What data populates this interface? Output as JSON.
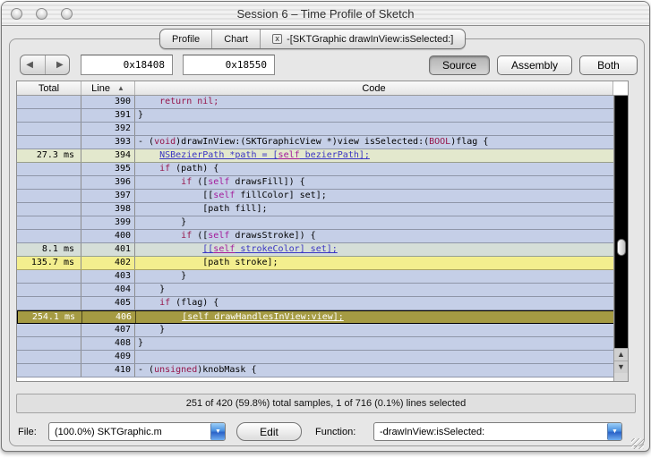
{
  "window": {
    "title": "Session 6 – Time Profile of Sketch"
  },
  "tabs": {
    "items": [
      {
        "label": "Profile"
      },
      {
        "label": "Chart"
      },
      {
        "label": "-[SKTGraphic drawInView:isSelected:]",
        "close_glyph": "x"
      }
    ]
  },
  "toolbar": {
    "back_glyph": "◀",
    "forward_glyph": "▶",
    "address_start": "0x18408",
    "address_end": "0x18550",
    "view_modes": {
      "source": "Source",
      "assembly": "Assembly",
      "both": "Both"
    }
  },
  "table": {
    "columns": {
      "total": "Total",
      "line": "Line",
      "code": "Code"
    },
    "sort_glyph": "▲",
    "rows": [
      {
        "total": "",
        "line": "390",
        "bg": "normal",
        "code": [
          [
            "    ",
            "p"
          ],
          [
            "return nil;",
            "k"
          ]
        ]
      },
      {
        "total": "",
        "line": "391",
        "bg": "normal",
        "code": [
          [
            "}",
            "p"
          ]
        ]
      },
      {
        "total": "",
        "line": "392",
        "bg": "normal",
        "code": []
      },
      {
        "total": "",
        "line": "393",
        "bg": "normal",
        "code": [
          [
            "- (",
            "p"
          ],
          [
            "void",
            "k"
          ],
          [
            ")drawInView:(SKTGraphicView *)view isSelected:(",
            "p"
          ],
          [
            "BOOL",
            "k"
          ],
          [
            ")flag {",
            "p"
          ]
        ]
      },
      {
        "total": "27.3 ms",
        "line": "394",
        "bg": "green",
        "code": [
          [
            "    ",
            "p"
          ],
          [
            "NSBezierPath *path = [",
            "bu"
          ],
          [
            "self",
            "su"
          ],
          [
            " bezierPath];",
            "bu"
          ]
        ]
      },
      {
        "total": "",
        "line": "395",
        "bg": "normal",
        "code": [
          [
            "    ",
            "p"
          ],
          [
            "if",
            "k"
          ],
          [
            " (path) {",
            "p"
          ]
        ]
      },
      {
        "total": "",
        "line": "396",
        "bg": "normal",
        "code": [
          [
            "        ",
            "p"
          ],
          [
            "if",
            "k"
          ],
          [
            " ([",
            "p"
          ],
          [
            "self",
            "s"
          ],
          [
            " drawsFill]) {",
            "p"
          ]
        ]
      },
      {
        "total": "",
        "line": "397",
        "bg": "normal",
        "code": [
          [
            "            [[",
            "p"
          ],
          [
            "self",
            "s"
          ],
          [
            " fillColor] set];",
            "p"
          ]
        ]
      },
      {
        "total": "",
        "line": "398",
        "bg": "normal",
        "code": [
          [
            "            [path fill];",
            "p"
          ]
        ]
      },
      {
        "total": "",
        "line": "399",
        "bg": "normal",
        "code": [
          [
            "        }",
            "p"
          ]
        ]
      },
      {
        "total": "",
        "line": "400",
        "bg": "normal",
        "code": [
          [
            "        ",
            "p"
          ],
          [
            "if",
            "k"
          ],
          [
            " ([",
            "p"
          ],
          [
            "self",
            "s"
          ],
          [
            " drawsStroke]) {",
            "p"
          ]
        ]
      },
      {
        "total": "8.1 ms",
        "line": "401",
        "bg": "gray",
        "code": [
          [
            "            ",
            "p"
          ],
          [
            "[[",
            "bu"
          ],
          [
            "self",
            "su"
          ],
          [
            " strokeColor] set];",
            "bu"
          ]
        ]
      },
      {
        "total": "135.7 ms",
        "line": "402",
        "bg": "yellow",
        "code": [
          [
            "            [path stroke];",
            "p"
          ]
        ]
      },
      {
        "total": "",
        "line": "403",
        "bg": "normal",
        "code": [
          [
            "        }",
            "p"
          ]
        ]
      },
      {
        "total": "",
        "line": "404",
        "bg": "normal",
        "code": [
          [
            "    }",
            "p"
          ]
        ]
      },
      {
        "total": "",
        "line": "405",
        "bg": "normal",
        "code": [
          [
            "    ",
            "p"
          ],
          [
            "if",
            "k"
          ],
          [
            " (flag) {",
            "p"
          ]
        ]
      },
      {
        "total": "254.1 ms",
        "line": "406",
        "bg": "sel",
        "code": [
          [
            "        ",
            "p"
          ],
          [
            "[self drawHandlesInView:view];",
            "wu"
          ]
        ]
      },
      {
        "total": "",
        "line": "407",
        "bg": "normal",
        "code": [
          [
            "    }",
            "p"
          ]
        ]
      },
      {
        "total": "",
        "line": "408",
        "bg": "normal",
        "code": [
          [
            "}",
            "p"
          ]
        ]
      },
      {
        "total": "",
        "line": "409",
        "bg": "normal",
        "code": []
      },
      {
        "total": "",
        "line": "410",
        "bg": "normal",
        "code": [
          [
            "- (",
            "p"
          ],
          [
            "unsigned",
            "k"
          ],
          [
            ")knobMask {",
            "p"
          ]
        ]
      }
    ]
  },
  "scrollbar": {
    "up_glyph": "▲",
    "down_glyph": "▼"
  },
  "status_bar": {
    "text": "251 of 420 (59.8%) total samples, 1 of 716 (0.1%) lines selected"
  },
  "footer": {
    "file_label": "File:",
    "file_value": "(100.0%) SKTGraphic.m",
    "edit_button": "Edit",
    "function_label": "Function:",
    "function_value": "-drawInView:isSelected:",
    "popup_arrow_glyph": "▼"
  },
  "colors": {
    "row_normal": "#c5cfe7",
    "row_hot_green": "#e3e8cd",
    "row_hot_gray": "#d5ded8",
    "row_hot_yellow": "#f3ee8e",
    "row_selected": "#a59b43",
    "keyword": "#96154a",
    "self_keyword": "#a31a9b",
    "link": "#3a35c4"
  }
}
